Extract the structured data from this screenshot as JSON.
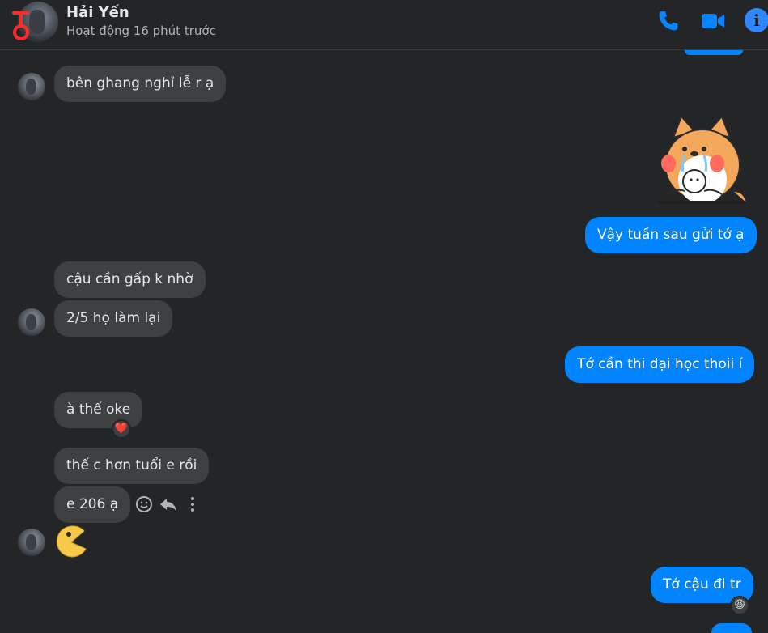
{
  "header": {
    "name": "Hải Yến",
    "status": "Hoạt động 16 phút trước"
  },
  "messages": [
    {
      "text": "bên ghang nghỉ lễ r ạ"
    },
    {
      "text": "Vậy tuần sau gửi tớ ạ"
    },
    {
      "text": "cậu cần gấp k nhờ"
    },
    {
      "text": "2/5 họ làm lại"
    },
    {
      "text": "Tớ cần thi đại học thoii í"
    },
    {
      "text": "à thế oke"
    },
    {
      "text": "thế c hơn tuổi e rồi"
    },
    {
      "text": "e 206 ạ"
    },
    {
      "text": "Tớ cậu đi tr"
    }
  ],
  "reactions": {
    "heart": "❤️",
    "laugh": "😆"
  },
  "colors": {
    "background": "#242526",
    "incoming_bubble": "#3e4042",
    "outgoing_bubble": "#0084ff",
    "accent": "#0084ff"
  },
  "icons": {
    "phone": "phone-icon",
    "video": "video-icon",
    "info": "info-icon",
    "react": "smiley-icon",
    "reply": "reply-icon",
    "more": "more-vertical-icon"
  }
}
